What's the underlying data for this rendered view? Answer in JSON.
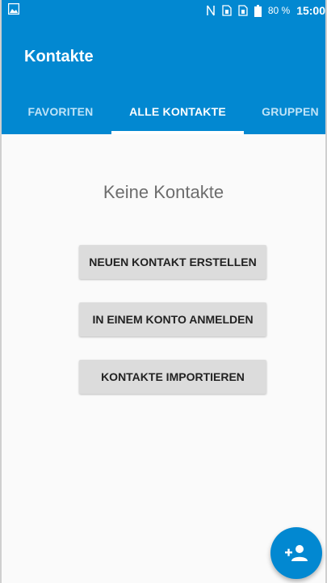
{
  "status_bar": {
    "battery_percent": "80 %",
    "time": "15:00",
    "icons": [
      "gallery-notification-icon",
      "nfc-icon",
      "sim-card-icon",
      "sim-card-icon",
      "battery-icon"
    ]
  },
  "app_bar": {
    "title": "Kontakte",
    "accent_color": "#0288d1"
  },
  "tabs": [
    {
      "label": "FAVORITEN",
      "active": false
    },
    {
      "label": "ALLE KONTAKTE",
      "active": true
    },
    {
      "label": "GRUPPEN",
      "active": false
    }
  ],
  "main": {
    "empty_message": "Keine Kontakte",
    "buttons": [
      {
        "label": "NEUEN KONTAKT ERSTELLEN"
      },
      {
        "label": "IN EINEM KONTO ANMELDEN"
      },
      {
        "label": "KONTAKTE IMPORTIEREN"
      }
    ]
  },
  "fab": {
    "icon": "add-contact-icon"
  }
}
